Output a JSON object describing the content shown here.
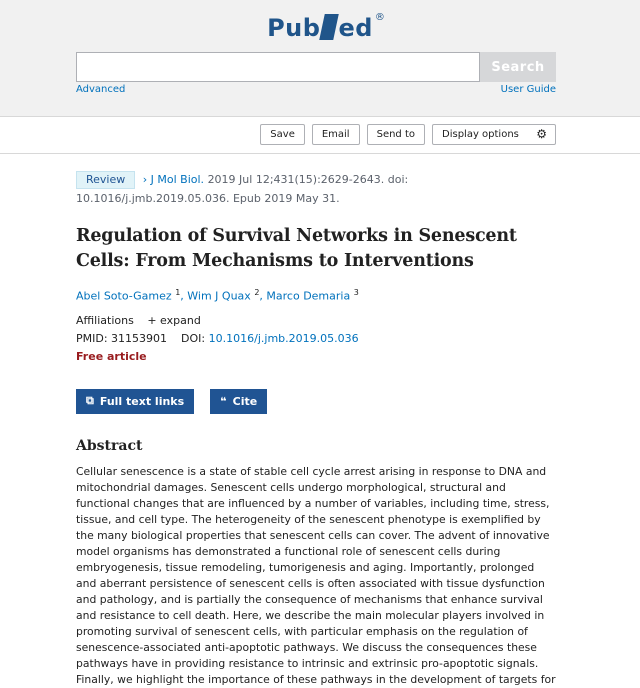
{
  "header": {
    "logo_text_left": "Pub",
    "logo_text_right": "ed",
    "logo_reg": "®",
    "search_placeholder": "",
    "search_button": "Search",
    "advanced_link": "Advanced",
    "user_guide_link": "User Guide"
  },
  "actions": {
    "save": "Save",
    "email": "Email",
    "send_to": "Send to",
    "display_options": "Display options"
  },
  "article": {
    "badge": "Review",
    "journal": "J Mol Biol.",
    "citation_rest": "2019 Jul 12;431(15):2629-2643. doi: 10.1016/j.jmb.2019.05.036. Epub 2019 May 31.",
    "title": "Regulation of Survival Networks in Senescent Cells: From Mechanisms to Interventions",
    "authors": [
      {
        "name": "Abel Soto-Gamez",
        "sup": "1"
      },
      {
        "name": "Wim J Quax",
        "sup": "2"
      },
      {
        "name": "Marco Demaria",
        "sup": "3"
      }
    ],
    "affiliations_label": "Affiliations",
    "expand_label": "expand",
    "pmid_label": "PMID:",
    "pmid": "31153901",
    "doi_label": "DOI:",
    "doi": "10.1016/j.jmb.2019.05.036",
    "free_label": "Free article",
    "full_text_button": "Full text links",
    "cite_button": "Cite",
    "abstract_heading": "Abstract",
    "abstract": "Cellular senescence is a state of stable cell cycle arrest arising in response to DNA and mitochondrial damages. Senescent cells undergo morphological, structural and functional changes that are influenced by a number of variables, including time, stress, tissue, and cell type. The heterogeneity of the senescent phenotype is exemplified by the many biological properties that senescent cells can cover. The advent of innovative model organisms has demonstrated a functional role of senescent cells during embryogenesis, tissue remodeling, tumorigenesis and aging. Importantly, prolonged and aberrant persistence of senescent cells is often associated with tissue dysfunction and pathology, and is partially the consequence of mechanisms that enhance survival and resistance to cell death. Here, we describe the main molecular players involved in promoting survival of senescent cells, with particular emphasis on the regulation of senescence-associated anti-apoptotic pathways. We discuss the consequences these pathways have in providing resistance to intrinsic and extrinsic pro-apoptotic signals. Finally, we highlight the importance of these pathways in the development of targets for"
  },
  "icons": {
    "external_link": "external-link-icon",
    "quote": "quote-icon",
    "gear": "gear-icon",
    "plus": "plus-icon",
    "chevron": "chevron-right-icon"
  }
}
